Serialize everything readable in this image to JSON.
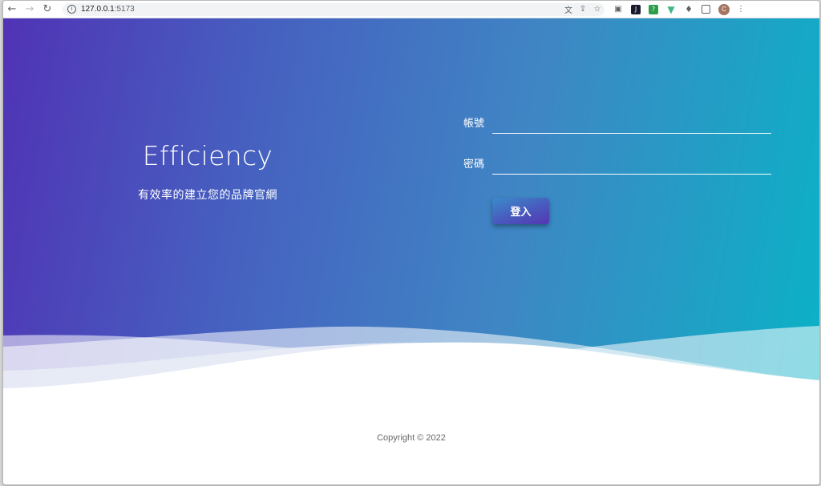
{
  "browser": {
    "url_host": "127.0.0.1",
    "url_port": ":5173",
    "profile_initial": "C",
    "icons": [
      "back-icon",
      "forward-icon",
      "reload-icon",
      "info-icon",
      "translate-icon",
      "share-icon",
      "bookmark-star-icon",
      "camera-icon",
      "extension-icon",
      "extension-icon",
      "vue-devtools-icon",
      "puzzle-icon",
      "sidepanel-icon",
      "avatar",
      "more-icon"
    ]
  },
  "brand": {
    "title": "Efficiency",
    "subtitle": "有效率的建立您的品牌官網"
  },
  "login": {
    "account_label": "帳號",
    "account_value": "",
    "password_label": "密碼",
    "password_value": "",
    "submit_label": "登入"
  },
  "footer": {
    "copyright": "Copyright © 2022"
  },
  "colors": {
    "gradient_start": "#5033b5",
    "gradient_end": "#0ab2c6",
    "footer_text": "#666666"
  }
}
